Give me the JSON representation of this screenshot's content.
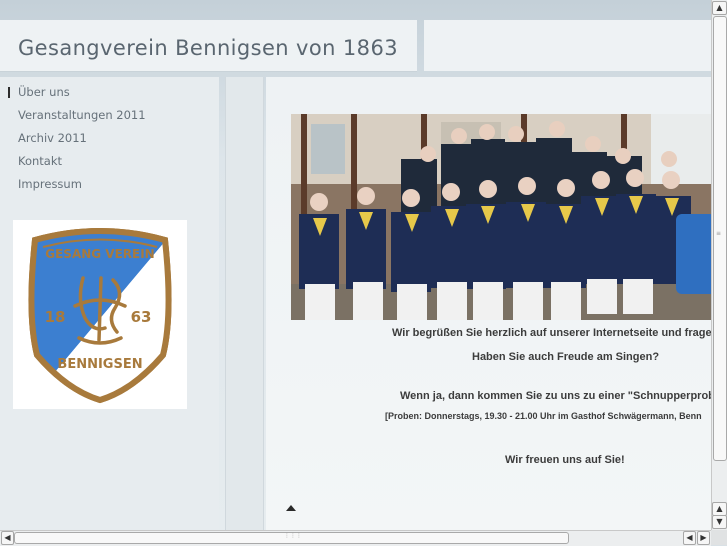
{
  "header": {
    "title": "Gesangverein Bennigsen von 1863"
  },
  "sidebar": {
    "items": [
      {
        "label": "Über uns",
        "active": true
      },
      {
        "label": "Veranstaltungen 2011",
        "active": false
      },
      {
        "label": "Archiv 2011",
        "active": false
      },
      {
        "label": "Kontakt",
        "active": false
      },
      {
        "label": "Impressum",
        "active": false
      }
    ],
    "logo": {
      "top_text": "GESANG VEREIN",
      "year_left": "18",
      "year_right": "63",
      "bottom_text": "BENNIGSEN",
      "colors": {
        "blue": "#3c7fd0",
        "white": "#ffffff",
        "border": "#a87a3c"
      }
    }
  },
  "main": {
    "lines": [
      "Wir begrüßen Sie herzlich auf unserer Internetseite und fragen",
      "Haben Sie auch Freude am Singen?",
      "Wenn ja, dann kommen Sie zu uns zu einer \"Schnupperprobe",
      "[Proben: Donnerstags, 19.30 - 21.00 Uhr im Gasthof Schwägermann, Benn",
      "Wir freuen uns auf Sie!"
    ]
  },
  "colors": {
    "title_text": "#5a6670",
    "nav_text": "#66717a",
    "body_text": "#3c3c3c"
  },
  "icons": {
    "back_to_top": "triangle-up-icon"
  }
}
